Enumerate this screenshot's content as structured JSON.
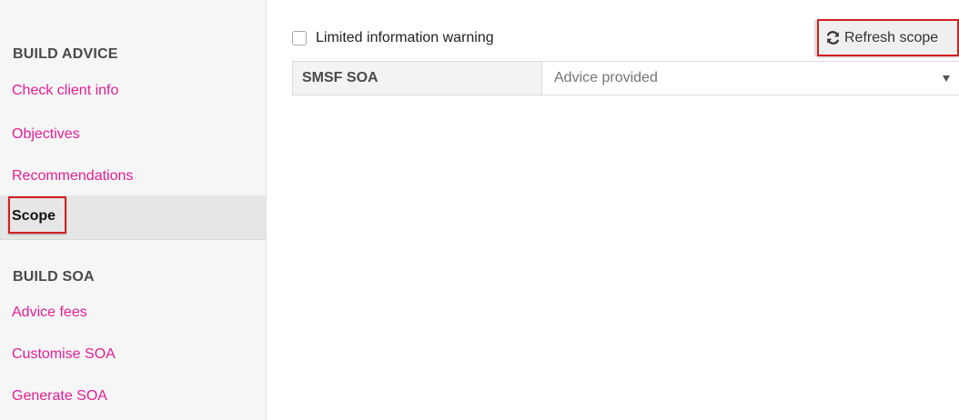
{
  "sidebar": {
    "build_advice_heading": "BUILD ADVICE",
    "build_advice_items": [
      {
        "label": "Check client info"
      },
      {
        "label": "Objectives"
      },
      {
        "label": "Recommendations"
      },
      {
        "label": "Scope",
        "active": true
      }
    ],
    "build_soa_heading": "BUILD SOA",
    "build_soa_items": [
      {
        "label": "Advice fees"
      },
      {
        "label": "Customise SOA"
      },
      {
        "label": "Generate SOA"
      }
    ]
  },
  "main": {
    "limited_info_checkbox": {
      "label": "Limited information warning",
      "checked": false
    },
    "refresh_button": {
      "label": "Refresh scope",
      "icon": "refresh-icon"
    },
    "scope_row": {
      "label": "SMSF SOA",
      "select_value": "Advice provided"
    }
  },
  "colors": {
    "link": "#e21f96",
    "highlight_outline": "#d21f1f",
    "sidebar_bg": "#f6f6f6"
  }
}
